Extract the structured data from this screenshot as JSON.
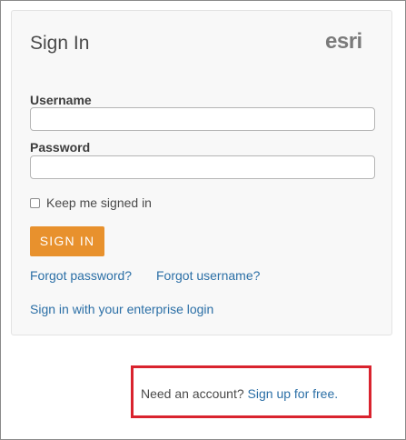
{
  "signin_card": {
    "title": "Sign In",
    "logo_text": "esri",
    "username_label": "Username",
    "username_value": "",
    "password_label": "Password",
    "password_value": "",
    "keep_signed_in_label": "Keep me signed in",
    "keep_signed_in_checked": false,
    "signin_button_label": "SIGN IN",
    "forgot_password_link": "Forgot password?",
    "forgot_username_link": "Forgot username?",
    "enterprise_link": "Sign in with your enterprise login"
  },
  "signup": {
    "prompt_text": "Need an account?",
    "link_text": "Sign up for free."
  },
  "colors": {
    "accent_button": "#e8912d",
    "link": "#2b6fa6",
    "highlight_border": "#d9232e"
  },
  "icons": {
    "logo": "esri-logo"
  }
}
